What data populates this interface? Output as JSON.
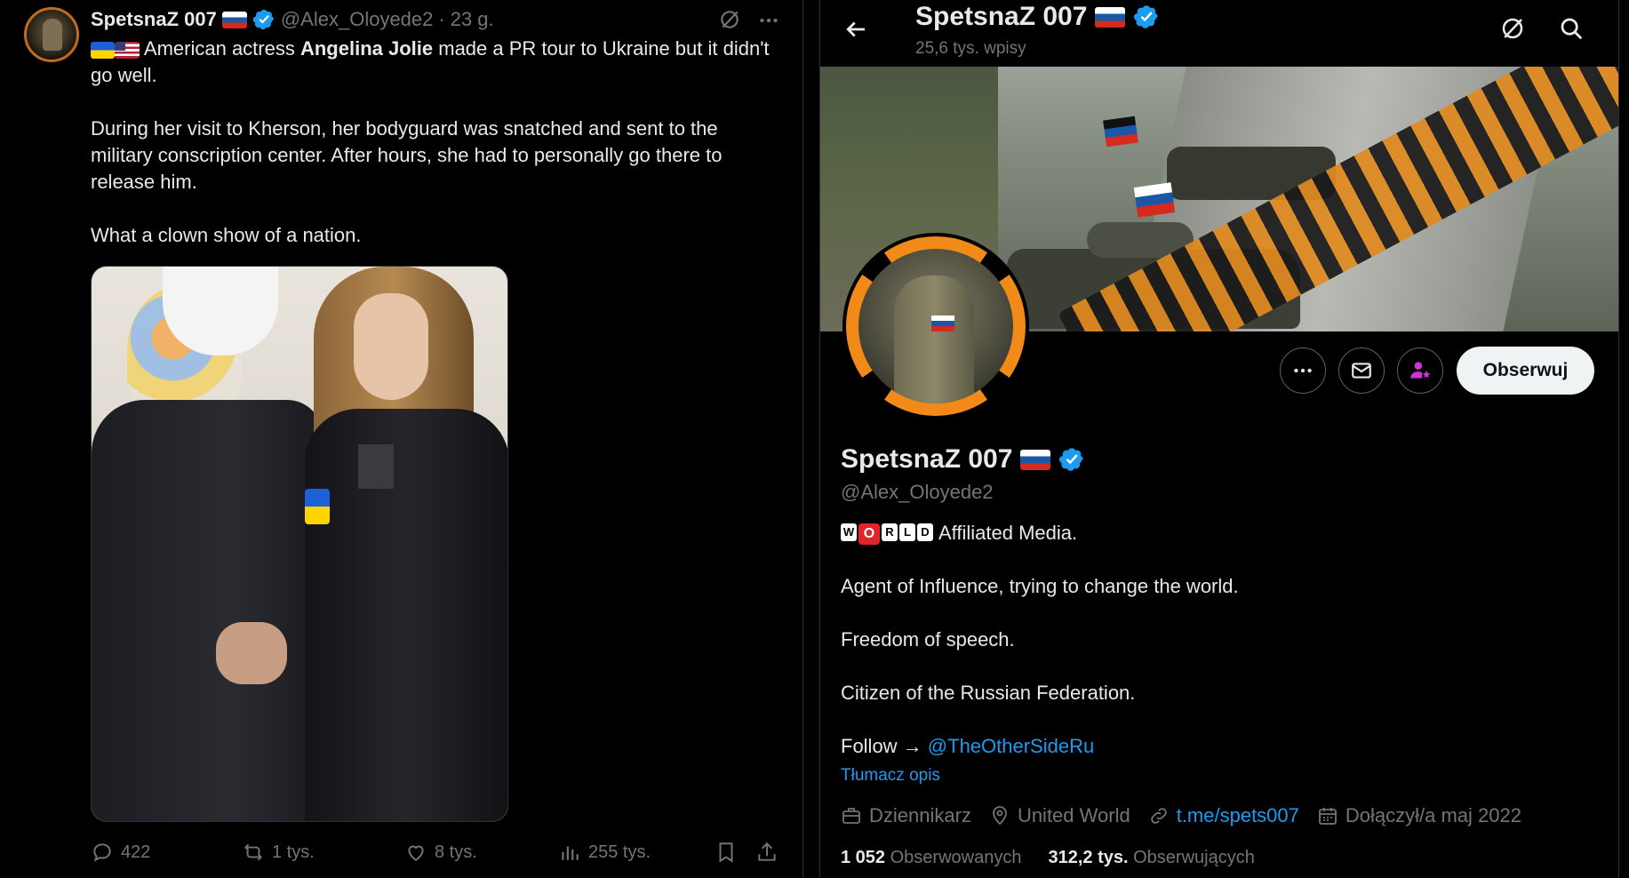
{
  "tweet": {
    "author_name": "SpetsnaZ 007",
    "handle": "@Alex_Oloyede2",
    "dot": "·",
    "time": "23 g.",
    "text_intro": "American actress ",
    "text_bold": "Angelina Jolie",
    "text_rest": " made a PR tour to Ukraine but it didn't go well.",
    "paragraph2": "During her visit to Kherson, her bodyguard was snatched and sent to the military conscription center. After hours, she had to personally go there to release him.",
    "paragraph3": "What a clown show of a nation.",
    "actions": {
      "replies": "422",
      "reposts": "1 tys.",
      "likes": "8 tys.",
      "views": "255 tys."
    }
  },
  "profile": {
    "top_name": "SpetsnaZ 007",
    "posts_count": "25,6 tys. wpisy",
    "follow_label": "Obserwuj",
    "name": "SpetsnaZ 007",
    "handle": "@Alex_Oloyede2",
    "world_letters": [
      "W",
      "O",
      "R",
      "L",
      "D"
    ],
    "bio_line1": "Affiliated Media.",
    "bio_line2": "Agent of Influence, trying to change the world.",
    "bio_line3": "Freedom of speech.",
    "bio_line4": "Citizen of the Russian Federation.",
    "bio_follow_prefix": "Follow → ",
    "bio_follow_link": "@TheOtherSideRu",
    "translate": "Tłumacz opis",
    "meta": {
      "profession": "Dziennikarz",
      "location": "United World",
      "website": "t.me/spets007",
      "joined": "Dołączył/a maj 2022"
    },
    "stats": {
      "following_count": "1 052",
      "following_label": "Obserwowanych",
      "followers_count": "312,2 tys.",
      "followers_label": "Obserwujących"
    }
  },
  "colors": {
    "accent": "#1d9bf0",
    "muted": "#71767b",
    "text": "#e7e9ea",
    "background": "#000000",
    "avatar_ring": "#f28a1a"
  },
  "icons": [
    "grok-icon",
    "more-icon",
    "reply-icon",
    "repost-icon",
    "like-icon",
    "views-icon",
    "bookmark-icon",
    "share-icon",
    "back-arrow-icon",
    "search-icon",
    "message-icon",
    "subscribe-icon",
    "briefcase-icon",
    "location-icon",
    "link-icon",
    "calendar-icon",
    "verified-badge-icon"
  ]
}
